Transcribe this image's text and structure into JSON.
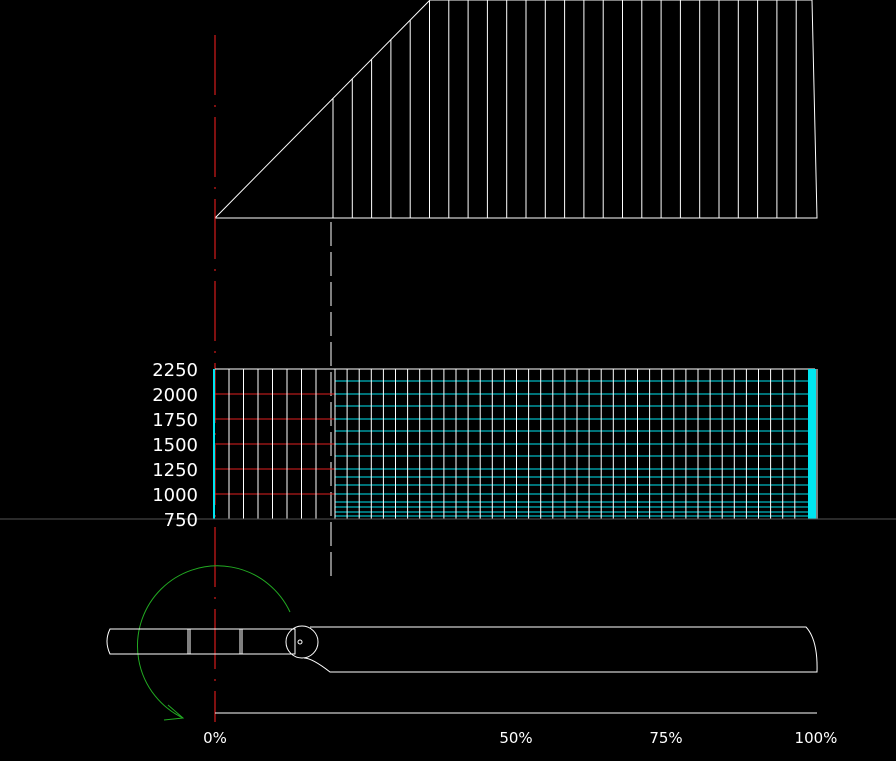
{
  "colors": {
    "background": "#000000",
    "lines": "#ffffff",
    "axis_red": "#ff2020",
    "grid_red": "#e02020",
    "grid_cyan": "#00e5f0",
    "rotation_arrow": "#22aa22",
    "baseline_gray": "#555555"
  },
  "chart_data": {
    "type": "diagram",
    "y_axis_ticks": [
      "2250",
      "2000",
      "1750",
      "1500",
      "1250",
      "1000",
      "750"
    ],
    "x_axis_ticks": [
      "0%",
      "50%",
      "75%",
      "100%"
    ],
    "icons": [
      "rotation-arrow-icon",
      "hinge-circle-icon"
    ]
  }
}
